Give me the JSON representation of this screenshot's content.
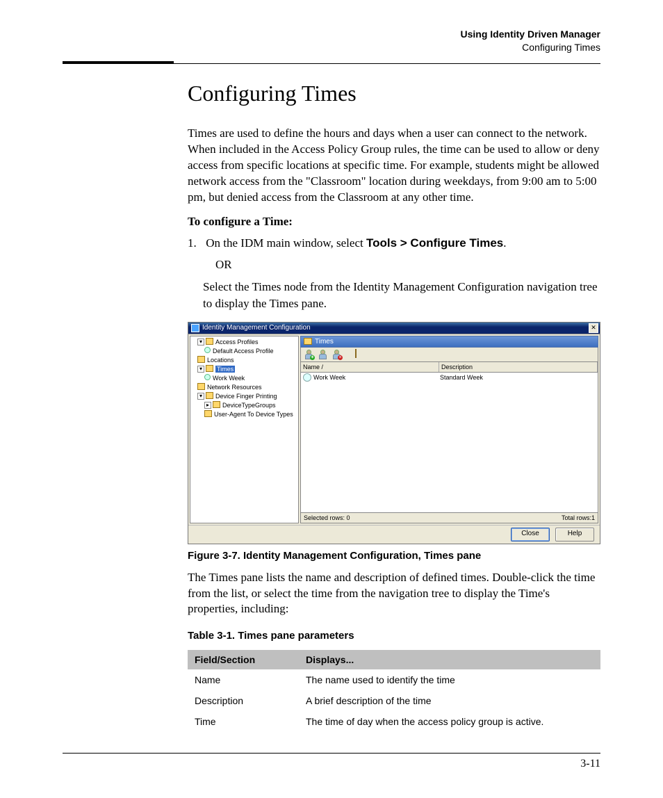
{
  "header": {
    "line1": "Using Identity Driven Manager",
    "line2": "Configuring Times"
  },
  "title": "Configuring Times",
  "intro": "Times are used to define the hours and days when a user can connect to the network. When included in the Access Policy Group rules, the time can be used to allow or deny access from specific locations at specific time. For example, students might be allowed network access from the \"Classroom\" location during weekdays, from 9:00 am to 5:00 pm, but denied access from the Classroom at any other time.",
  "config_lead": "To configure a Time:",
  "step1_prefix": "1.",
  "step1_a": "On the IDM main window, select ",
  "step1_b": "Tools > Configure Times",
  "step1_c": ".",
  "or_text": "OR",
  "step1_alt": "Select the Times node from the Identity Management Configuration navigation tree to display the Times pane.",
  "screenshot": {
    "window_title": "Identity Management Configuration",
    "close_glyph": "✕",
    "tree": {
      "access_profiles": "Access Profiles",
      "default_access_profile": "Default Access Profile",
      "locations": "Locations",
      "times": "Times",
      "work_week": "Work Week",
      "network_resources": "Network Resources",
      "device_finger_printing": "Device Finger Printing",
      "device_type_groups": "DeviceTypeGroups",
      "user_agent_to_device_types": "User-Agent To Device Types"
    },
    "pane_title": "Times",
    "columns": {
      "name": "Name  /",
      "description": "Description"
    },
    "rows": [
      {
        "name": "Work Week",
        "description": "Standard Week"
      }
    ],
    "status_left": "Selected rows: 0",
    "status_right": "Total rows:1",
    "buttons": {
      "close": "Close",
      "help": "Help"
    }
  },
  "figure_caption": "Figure 3-7. Identity Management Configuration, Times pane",
  "after_figure": "The Times pane lists the name and description of defined times. Double-click the time from the list, or select the time from the navigation tree to display the Time's properties, including:",
  "table_caption": "Table 3-1.    Times pane parameters",
  "param_table": {
    "headers": {
      "field": "Field/Section",
      "displays": "Displays..."
    },
    "rows": [
      {
        "field": "Name",
        "displays": "The name used to identify the time"
      },
      {
        "field": "Description",
        "displays": "A brief description of the time"
      },
      {
        "field": "Time",
        "displays": "The time of day when the access policy group is active."
      }
    ]
  },
  "page_number": "3-11"
}
